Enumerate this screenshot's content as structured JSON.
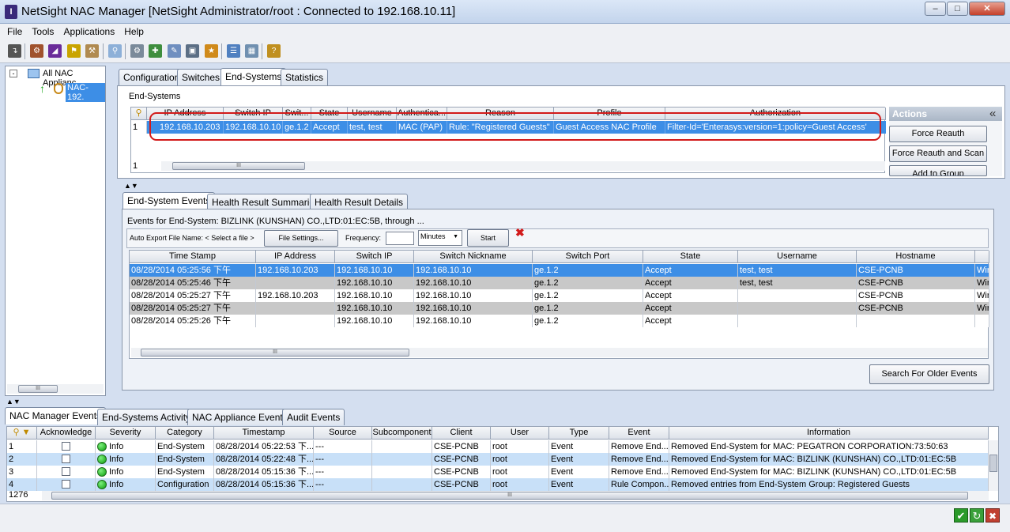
{
  "window": {
    "title": "NetSight NAC Manager [NetSight Administrator/root : Connected to 192.168.10.11]"
  },
  "menu": [
    "File",
    "Tools",
    "Applications",
    "Help"
  ],
  "tree": {
    "root": "All NAC Applianc",
    "child": "NAC-192."
  },
  "top_tabs": [
    "Configuration",
    "Switches",
    "End-Systems",
    "Statistics"
  ],
  "endsystems": {
    "group_label": "End-Systems",
    "columns": [
      "IP Address",
      "Switch IP",
      "Swit...",
      "State",
      "Username",
      "Authentica...",
      "Reason",
      "Profile",
      "Authorization"
    ],
    "row": {
      "num": "1",
      "cells": [
        "192.168.10.203",
        "192.168.10.10",
        "ge.1.2",
        "Accept",
        "test, test",
        "MAC (PAP)",
        "Rule: \"Registered Guests\"",
        "Guest Access NAC Profile",
        "Filter-Id='Enterasys:version=1:policy=Guest Access'"
      ]
    },
    "footer_num": "1"
  },
  "actions": {
    "title": "Actions",
    "collapse": "«",
    "buttons": [
      "Force Reauth",
      "Force Reauth and Scan",
      "Add to Group"
    ]
  },
  "sub_tabs": [
    "End-System Events",
    "Health Result Summaries",
    "Health Result Details"
  ],
  "events": {
    "caption": "Events for End-System: BIZLINK (KUNSHAN) CO.,LTD:01:EC:5B, through ...",
    "export_label": "Auto Export File Name: < Select a file >",
    "file_settings": "File Settings...",
    "frequency_label": "Frequency:",
    "frequency_value": "",
    "unit": "Minutes",
    "start": "Start",
    "columns": [
      "Time Stamp",
      "IP Address",
      "Switch IP",
      "Switch Nickname",
      "Switch Port",
      "State",
      "Username",
      "Hostname",
      ""
    ],
    "rows": [
      [
        "08/28/2014 05:25:56 下午",
        "192.168.10.203",
        "192.168.10.10",
        "192.168.10.10",
        "ge.1.2",
        "Accept",
        "test, test",
        "CSE-PCNB",
        "Wir"
      ],
      [
        "08/28/2014 05:25:46 下午",
        "",
        "192.168.10.10",
        "192.168.10.10",
        "ge.1.2",
        "Accept",
        "test, test",
        "CSE-PCNB",
        "Wir"
      ],
      [
        "08/28/2014 05:25:27 下午",
        "192.168.10.203",
        "192.168.10.10",
        "192.168.10.10",
        "ge.1.2",
        "Accept",
        "",
        "CSE-PCNB",
        "Wir"
      ],
      [
        "08/28/2014 05:25:27 下午",
        "",
        "192.168.10.10",
        "192.168.10.10",
        "ge.1.2",
        "Accept",
        "",
        "CSE-PCNB",
        "Wir"
      ],
      [
        "08/28/2014 05:25:26 下午",
        "",
        "192.168.10.10",
        "192.168.10.10",
        "ge.1.2",
        "Accept",
        "",
        "",
        ""
      ]
    ],
    "search_older": "Search For Older Events"
  },
  "bottom_tabs": [
    "NAC Manager Events",
    "End-Systems Activity",
    "NAC Appliance Events",
    "Audit Events"
  ],
  "log": {
    "columns": [
      "",
      "Acknowledge",
      "Severity",
      "Category",
      "Timestamp",
      "Source",
      "Subcomponent",
      "Client",
      "User",
      "Type",
      "Event",
      "Information"
    ],
    "rows": [
      [
        "1",
        "",
        "Info",
        "End-System",
        "08/28/2014 05:22:53 下...",
        "---",
        "",
        "CSE-PCNB",
        "root",
        "Event",
        "Remove End...",
        "Removed End-System for MAC: PEGATRON CORPORATION:73:50:63"
      ],
      [
        "2",
        "",
        "Info",
        "End-System",
        "08/28/2014 05:22:48 下...",
        "---",
        "",
        "CSE-PCNB",
        "root",
        "Event",
        "Remove End...",
        "Removed End-System for MAC: BIZLINK (KUNSHAN) CO.,LTD:01:EC:5B"
      ],
      [
        "3",
        "",
        "Info",
        "End-System",
        "08/28/2014 05:15:36 下...",
        "---",
        "",
        "CSE-PCNB",
        "root",
        "Event",
        "Remove End...",
        "Removed End-System for MAC: BIZLINK (KUNSHAN) CO.,LTD:01:EC:5B"
      ],
      [
        "4",
        "",
        "Info",
        "Configuration",
        "08/28/2014 05:15:36 下...",
        "---",
        "",
        "CSE-PCNB",
        "root",
        "Event",
        "Rule Compon...",
        "Removed entries from End-System Group: Registered Guests"
      ]
    ],
    "count": "1276"
  },
  "colors": {
    "selection": "#3d8ee6",
    "alt_row": "#c8c8c8",
    "highlight": "#d21a1a"
  }
}
